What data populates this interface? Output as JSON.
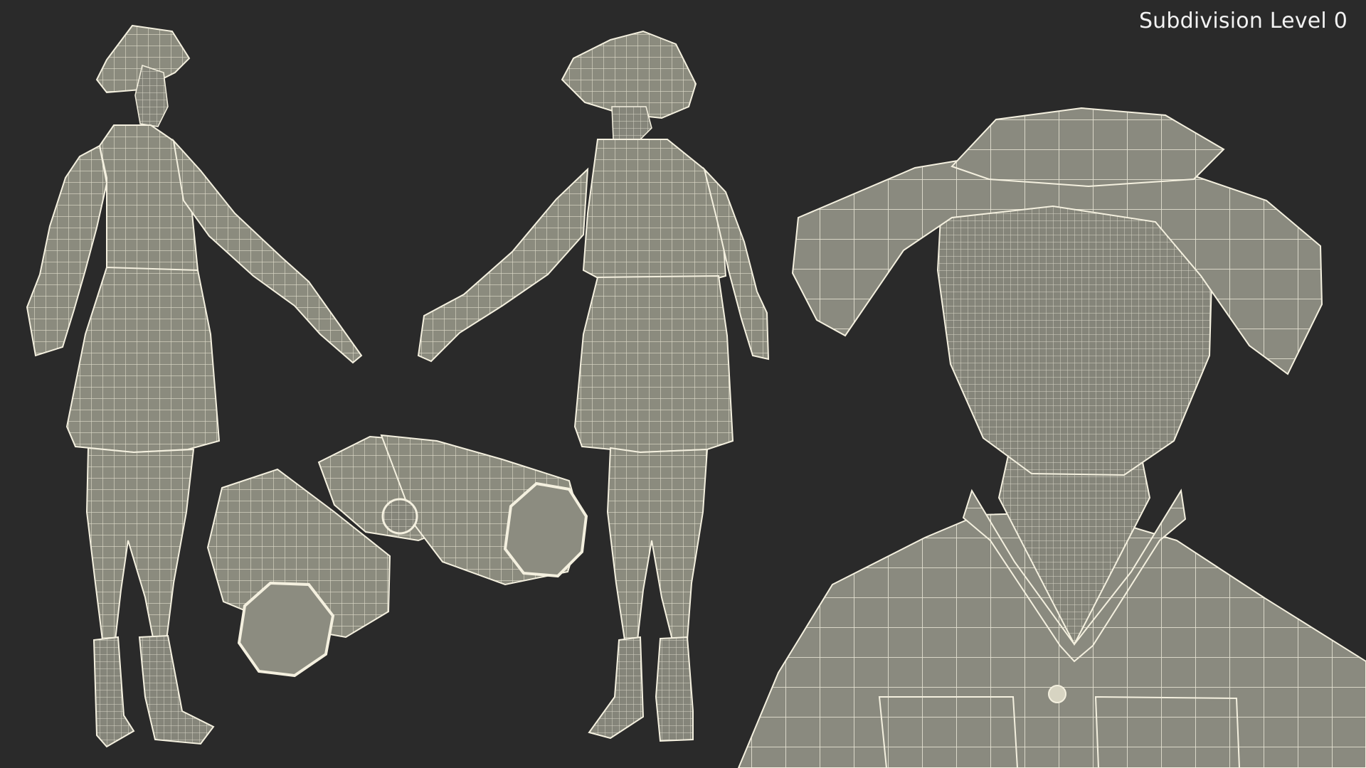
{
  "overlay": {
    "label": "Subdivision Level 0"
  },
  "colors": {
    "background": "#2a2a2a",
    "surface": "#8b8b7e",
    "wire": "#f4f0df",
    "label": "#f2f2f2"
  }
}
